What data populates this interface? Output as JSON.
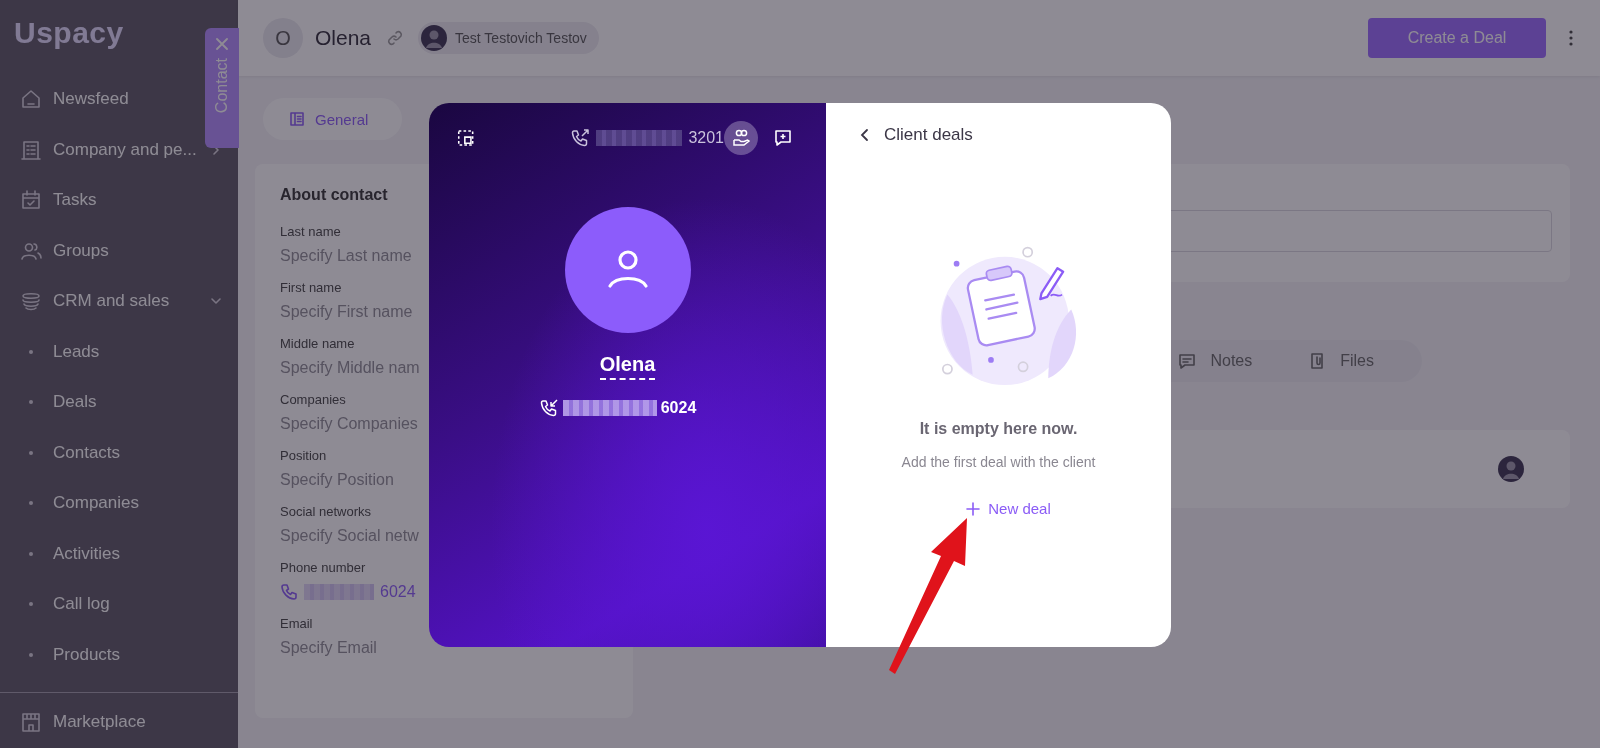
{
  "sidebar": {
    "logo": "Uspacy",
    "items": [
      {
        "label": "Newsfeed"
      },
      {
        "label": "Company and pe...",
        "expanded": false
      },
      {
        "label": "Tasks"
      },
      {
        "label": "Groups"
      },
      {
        "label": "CRM and sales",
        "expanded": true,
        "children": [
          {
            "label": "Leads"
          },
          {
            "label": "Deals"
          },
          {
            "label": "Contacts"
          },
          {
            "label": "Companies"
          },
          {
            "label": "Activities"
          },
          {
            "label": "Call log"
          },
          {
            "label": "Products"
          }
        ]
      }
    ],
    "footer_items": [
      {
        "label": "Marketplace"
      }
    ]
  },
  "contact_tab": {
    "label": "Contact"
  },
  "header": {
    "avatar_initial": "O",
    "name": "Olena",
    "responsible": "Test Testovich Testov",
    "create_button": "Create a Deal"
  },
  "tabs": [
    {
      "label": "General",
      "selected": true
    }
  ],
  "about_card": {
    "title": "About contact",
    "fields": [
      {
        "label": "Last name",
        "placeholder": "Specify Last name"
      },
      {
        "label": "First name",
        "placeholder": "Specify First name"
      },
      {
        "label": "Middle name",
        "placeholder": "Specify Middle nam"
      },
      {
        "label": "Companies",
        "placeholder": "Specify Companies"
      },
      {
        "label": "Position",
        "placeholder": "Specify Position"
      },
      {
        "label": "Social networks",
        "placeholder": "Specify Social netw"
      },
      {
        "label": "Phone number",
        "value": "6024",
        "kind": "phone"
      },
      {
        "label": "Email",
        "placeholder": "Specify Email"
      }
    ]
  },
  "activity_tabs": [
    {
      "label": "Notes",
      "selected": false
    },
    {
      "label": "Files",
      "selected": false
    }
  ],
  "call_modal": {
    "caller_number": "3201",
    "contact_name": "Olena",
    "contact_number": "6024",
    "toolbar": [
      {
        "kind": "deals",
        "selected": true
      },
      {
        "kind": "chat",
        "selected": false
      }
    ],
    "deals_panel": {
      "title": "Client deals",
      "empty_title": "It is empty here now.",
      "empty_text": "Add the first deal with the client",
      "new_deal_button": "New deal"
    }
  }
}
